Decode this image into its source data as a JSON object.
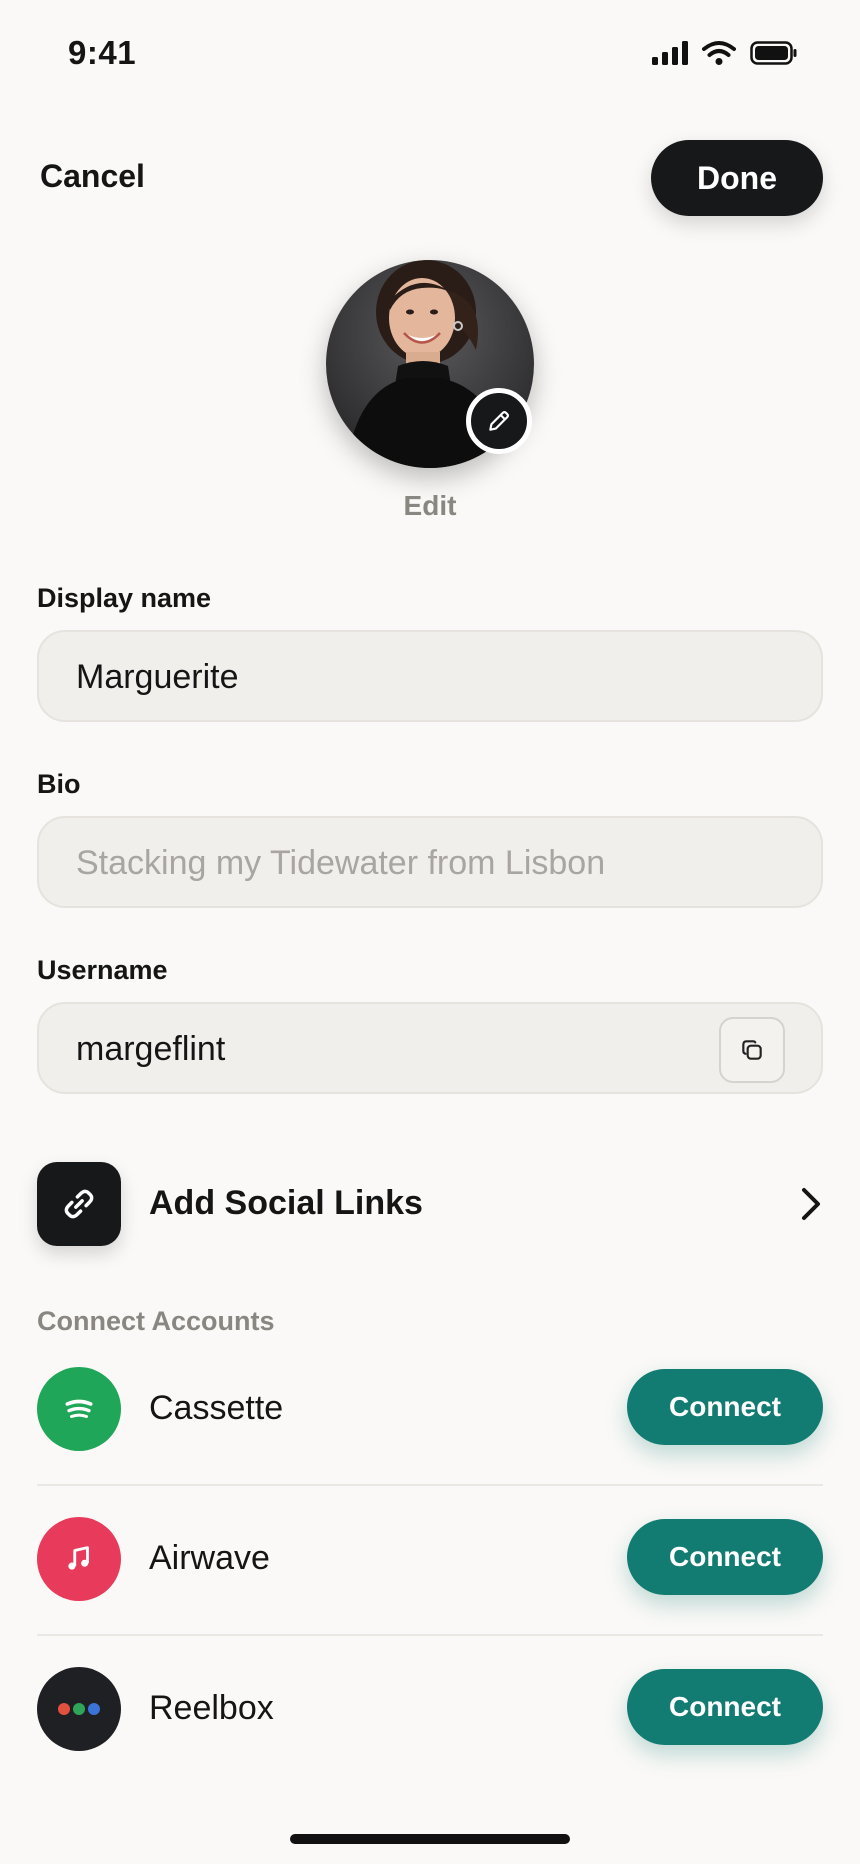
{
  "status_bar": {
    "time": "9:41"
  },
  "nav": {
    "cancel_label": "Cancel",
    "done_label": "Done"
  },
  "avatar": {
    "edit_label": "Edit"
  },
  "fields": {
    "display_name": {
      "label": "Display name",
      "value": "Marguerite"
    },
    "bio": {
      "label": "Bio",
      "placeholder": "Stacking my Tidewater from Lisbon"
    },
    "username": {
      "label": "Username",
      "value": "margeflint"
    }
  },
  "social": {
    "label": "Add Social Links"
  },
  "connect_accounts": {
    "section_label": "Connect Accounts",
    "accounts": [
      {
        "name": "Cassette",
        "button": "Connect",
        "color": "#1fa659"
      },
      {
        "name": "Airwave",
        "button": "Connect",
        "color": "#e83a5a"
      },
      {
        "name": "Reelbox",
        "button": "Connect",
        "color": "#1f2024"
      }
    ]
  },
  "colors": {
    "accent": "#137c72",
    "dark": "#17181a",
    "background": "#faf9f7"
  }
}
